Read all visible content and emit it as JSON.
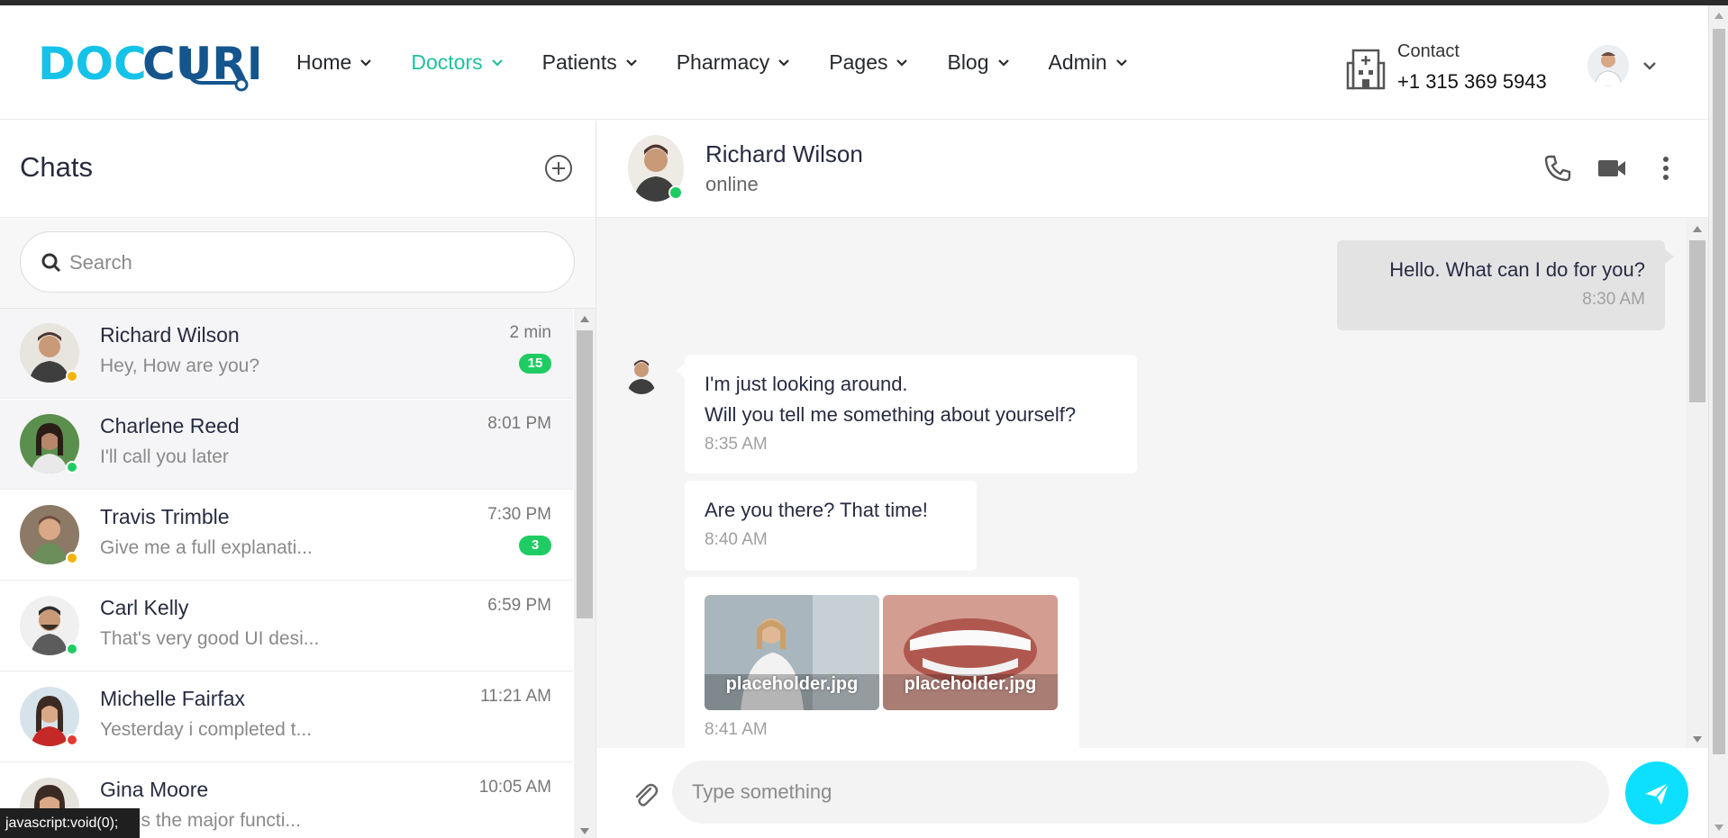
{
  "header": {
    "logo_text": "DOCCURE",
    "nav": [
      {
        "label": "Home",
        "active": false
      },
      {
        "label": "Doctors",
        "active": true
      },
      {
        "label": "Patients",
        "active": false
      },
      {
        "label": "Pharmacy",
        "active": false
      },
      {
        "label": "Pages",
        "active": false
      },
      {
        "label": "Blog",
        "active": false
      },
      {
        "label": "Admin",
        "active": false
      }
    ],
    "contact_label": "Contact",
    "contact_phone": "+1 315 369 5943"
  },
  "sidebar": {
    "title": "Chats",
    "search_placeholder": "Search",
    "chats": [
      {
        "name": "Richard Wilson",
        "message": "Hey, How are you?",
        "time": "2 min",
        "badge": "15",
        "status": "away",
        "selected": true
      },
      {
        "name": "Charlene Reed",
        "message": "I'll call you later",
        "time": "8:01 PM",
        "badge": "",
        "status": "online",
        "selected": true
      },
      {
        "name": "Travis Trimble",
        "message": "Give me a full explanati...",
        "time": "7:30 PM",
        "badge": "3",
        "status": "away",
        "selected": false
      },
      {
        "name": "Carl Kelly",
        "message": "That's very good UI desi...",
        "time": "6:59 PM",
        "badge": "",
        "status": "online",
        "selected": false
      },
      {
        "name": "Michelle Fairfax",
        "message": "Yesterday i completed t...",
        "time": "11:21 AM",
        "badge": "",
        "status": "busy",
        "selected": false
      },
      {
        "name": "Gina Moore",
        "message": "...at is the major functi...",
        "time": "10:05 AM",
        "badge": "",
        "status": "none",
        "selected": false
      }
    ]
  },
  "conversation": {
    "contact_name": "Richard Wilson",
    "contact_status": "online",
    "messages": {
      "m1_text": "Hello. What can I do for you?",
      "m1_time": "8:30 AM",
      "m2_line1": "I'm just looking around.",
      "m2_line2": "Will you tell me something about yourself?",
      "m2_time": "8:35 AM",
      "m3_text": "Are you there? That time!",
      "m3_time": "8:40 AM",
      "m4_attach1": "placeholder.jpg",
      "m4_attach2": "placeholder.jpg",
      "m4_time": "8:41 AM"
    },
    "composer_placeholder": "Type something"
  },
  "statusbar": {
    "text": "javascript:void(0);"
  },
  "colors": {
    "accent": "#0de0fe",
    "nav_active": "#20c0a0",
    "badge": "#1fcc63",
    "online": "#1fcc63",
    "away": "#f4b400",
    "busy": "#e53935"
  }
}
